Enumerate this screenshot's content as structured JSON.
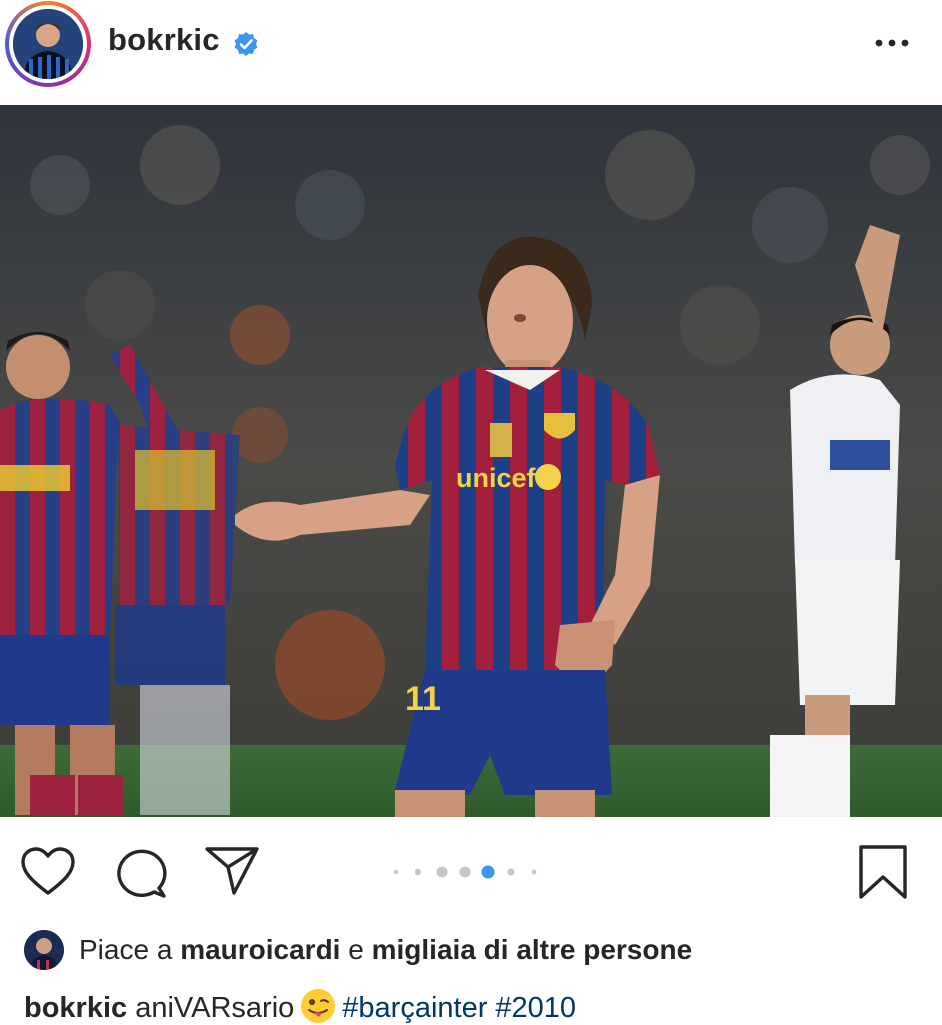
{
  "post": {
    "username": "bokrkic",
    "verified": true,
    "more_icon": "more-horizontal-icon"
  },
  "actions": {
    "like_icon": "heart-icon",
    "comment_icon": "comment-icon",
    "share_icon": "send-icon",
    "save_icon": "bookmark-icon"
  },
  "carousel": {
    "total": 7,
    "active_index": 4
  },
  "likes": {
    "prefix": "Piace a",
    "user": "mauroicardi",
    "connector": "e",
    "others": "migliaia di altre persone"
  },
  "caption": {
    "username": "bokrkic",
    "text": "aniVARsario",
    "emoji": "winking-face-with-tongue",
    "hashtags": "#barçainter #2010"
  },
  "colors": {
    "verified_blue": "#3897f0",
    "active_dot": "#3897f0",
    "hashtag": "#00376b",
    "text": "#262626"
  }
}
